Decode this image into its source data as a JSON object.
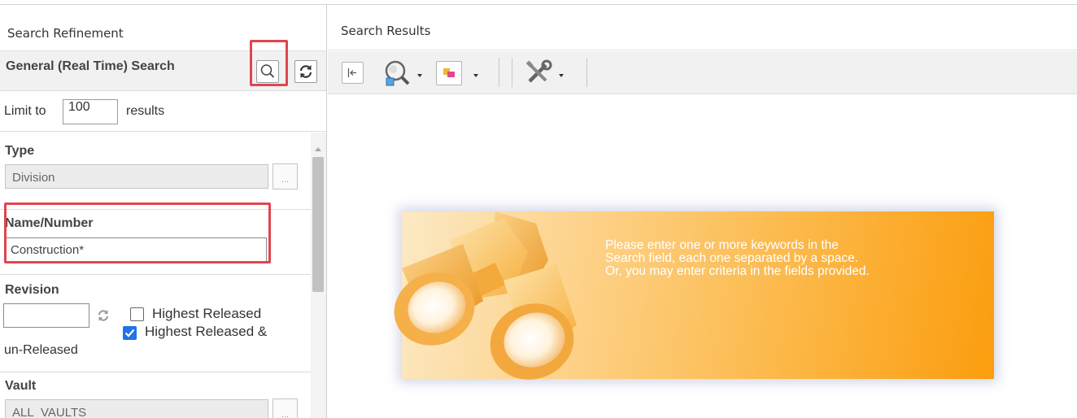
{
  "left_panel": {
    "header": "Search Refinement",
    "general_search_title": "General (Real Time) Search",
    "search_icon": "magnifier-icon",
    "refresh_icon": "refresh-icon",
    "limit": {
      "prefix": "Limit to",
      "value": "100",
      "suffix": "results"
    },
    "type": {
      "label": "Type",
      "value": "Division",
      "chooser": "..."
    },
    "name_number": {
      "label": "Name/Number",
      "value": "Construction*"
    },
    "revision": {
      "label": "Revision",
      "value": "",
      "option1": {
        "label": "Highest Released",
        "checked": false
      },
      "option2": {
        "label_line1": "Highest Released &",
        "label_line2": "un-Released",
        "checked": true
      }
    },
    "vault": {
      "label": "Vault",
      "value": "ALL_VAULTS",
      "chooser": "..."
    }
  },
  "right_panel": {
    "header": "Search Results",
    "toolbar_icons": [
      "collapse-panel-icon",
      "search-options-icon",
      "display-options-icon",
      "tools-icon"
    ],
    "empty_message_line1": "Please enter one or more keywords in the",
    "empty_message_line2": "Search field, each one separated by a space.",
    "empty_message_line3": "Or, you may enter criteria in the fields provided."
  },
  "colors": {
    "highlight": "#e0454f",
    "checkbox_checked": "#1e73e8",
    "banner_light": "#fce9c4",
    "banner_dark": "#fb9d0e"
  }
}
